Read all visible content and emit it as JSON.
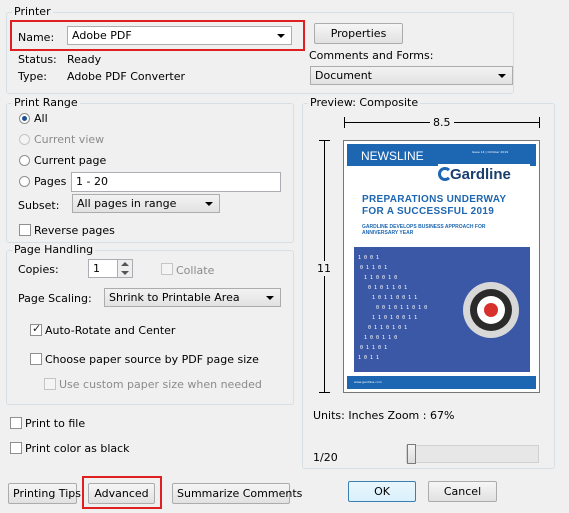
{
  "printer": {
    "legend": "Printer",
    "name_label": "Name:",
    "name_value": "Adobe PDF",
    "properties_button": "Properties",
    "status_label": "Status:",
    "status_value": "Ready",
    "type_label": "Type:",
    "type_value": "Adobe PDF Converter",
    "comments_forms_label": "Comments and Forms:",
    "comments_forms_value": "Document"
  },
  "print_range": {
    "legend": "Print Range",
    "all": "All",
    "current_view": "Current view",
    "current_page": "Current page",
    "pages": "Pages",
    "pages_value": "1 - 20",
    "subset_label": "Subset:",
    "subset_value": "All pages in range",
    "reverse_pages": "Reverse pages"
  },
  "page_handling": {
    "legend": "Page Handling",
    "copies_label": "Copies:",
    "copies_value": "1",
    "collate": "Collate",
    "page_scaling_label": "Page Scaling:",
    "page_scaling_value": "Shrink to Printable Area",
    "auto_rotate": "Auto-Rotate and Center",
    "choose_paper_source": "Choose paper source by PDF page size",
    "custom_paper_size": "Use custom paper size when needed"
  },
  "options": {
    "print_to_file": "Print to file",
    "print_color_black": "Print color as black"
  },
  "preview": {
    "legend": "Preview: Composite",
    "width_dim": "8.5",
    "height_dim": "11",
    "units_zoom": "Units: Inches Zoom :  67%",
    "page_indicator": "1/20",
    "newsletter_brand": "NEWSLINE",
    "issue_text": "Issue 14 | October 2019",
    "company_logo": "Gardline",
    "headline_line1": "PREPARATIONS UNDERWAY",
    "headline_line2": "FOR A SUCCESSFUL 2019",
    "subhead_line1": "GARDLINE DEVELOPS BUSINESS APPROACH FOR",
    "subhead_line2": "ANNIVERSARY YEAR",
    "footer_url": "www.gardline.com"
  },
  "buttons": {
    "printing_tips": "Printing Tips",
    "advanced": "Advanced",
    "summarize_comments": "Summarize Comments",
    "ok": "OK",
    "cancel": "Cancel"
  },
  "colors": {
    "highlight": "#e02020",
    "brand_blue": "#1d66b1"
  }
}
